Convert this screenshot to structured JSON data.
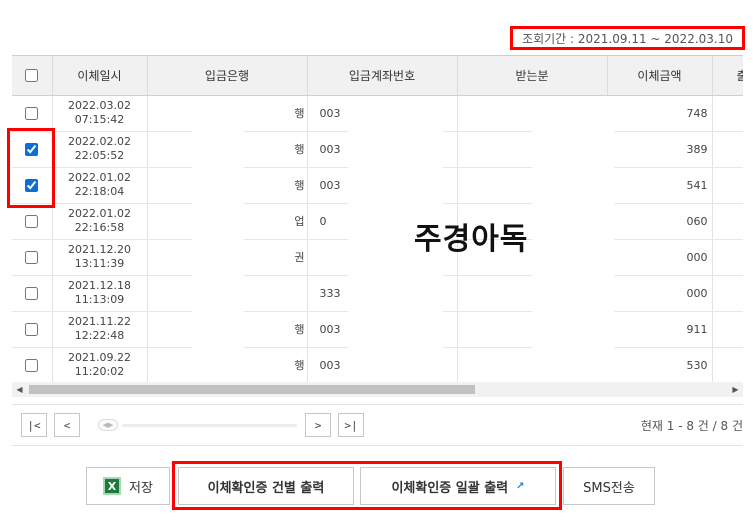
{
  "period_label": "조회기간 : 2021.09.11 ~ 2022.03.10",
  "columns": [
    "이체일시",
    "입금은행",
    "입금계좌번호",
    "받는분",
    "이체금액",
    "출"
  ],
  "rows": [
    {
      "date": "2022.03.02",
      "time": "07:15:42",
      "bank": "행",
      "account": "003",
      "amount": "748",
      "checked": false
    },
    {
      "date": "2022.02.02",
      "time": "22:05:52",
      "bank": "행",
      "account": "003",
      "amount": "389",
      "checked": true
    },
    {
      "date": "2022.01.02",
      "time": "22:18:04",
      "bank": "행",
      "account": "003",
      "amount": "541",
      "checked": true
    },
    {
      "date": "2022.01.02",
      "time": "22:16:58",
      "bank": "업",
      "account": "0",
      "amount": "060",
      "checked": false
    },
    {
      "date": "2021.12.20",
      "time": "13:11:39",
      "bank": "권",
      "account": "",
      "amount": "000",
      "checked": false
    },
    {
      "date": "2021.12.18",
      "time": "11:13:09",
      "bank": "",
      "account": "333",
      "amount": "000",
      "checked": false
    },
    {
      "date": "2021.11.22",
      "time": "12:22:48",
      "bank": "행",
      "account": "003",
      "amount": "911",
      "checked": false
    },
    {
      "date": "2021.09.22",
      "time": "11:20:02",
      "bank": "행",
      "account": "003",
      "amount": "530",
      "checked": false
    }
  ],
  "watermark": "주경아독",
  "pager": {
    "first": "|<",
    "prev": "<",
    "next": ">",
    "last": ">|",
    "info": "현재 1 - 8 건 / 8 건"
  },
  "buttons": {
    "save": "저장",
    "print_each": "이체확인증 건별 출력",
    "print_all": "이체확인증 일괄 출력",
    "sms": "SMS전송"
  }
}
